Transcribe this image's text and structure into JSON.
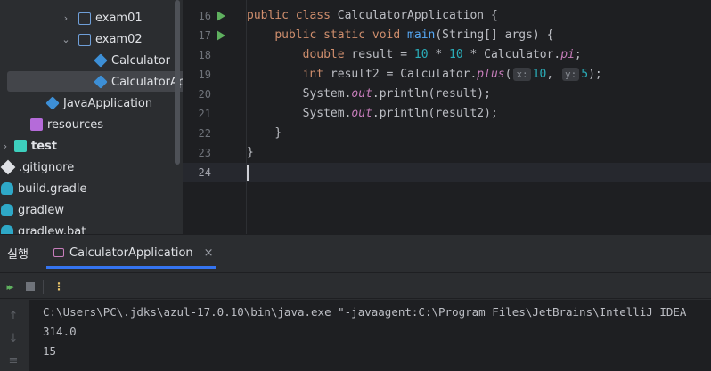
{
  "project_tree": {
    "items": [
      {
        "label": "exam01",
        "icon": "folder-icon",
        "expanded": false
      },
      {
        "label": "exam02",
        "icon": "folder-icon",
        "expanded": true
      },
      {
        "label": "Calculator",
        "icon": "class-icon"
      },
      {
        "label": "CalculatorApplication",
        "display": "CalculatorAp",
        "icon": "class-icon",
        "selected": true
      },
      {
        "label": "JavaApplication",
        "icon": "class-icon"
      },
      {
        "label": "resources",
        "icon": "resources-folder-icon"
      },
      {
        "label": "test",
        "icon": "test-folder-icon",
        "expanded": false
      },
      {
        "label": ".gitignore",
        "icon": "git-icon"
      },
      {
        "label": "build.gradle",
        "icon": "gradle-icon"
      },
      {
        "label": "gradlew",
        "icon": "gradle-icon"
      },
      {
        "label": "gradlew.bat",
        "icon": "gradle-icon"
      }
    ]
  },
  "editor": {
    "current_line": 24,
    "line_numbers": [
      "16",
      "17",
      "18",
      "19",
      "20",
      "21",
      "22",
      "23",
      "24"
    ],
    "lines": {
      "l16": {
        "kw1": "public",
        "kw2": "class",
        "name": "CalculatorApplication",
        "rest": " {"
      },
      "l17": {
        "kw1": "public",
        "kw2": "static",
        "kw3": "void",
        "fn": "main",
        "rest": "(String[] args) {"
      },
      "l18": {
        "kw": "double",
        "pre": " result = ",
        "n1": "10",
        "mid": " * ",
        "n2": "10",
        "mid2": " * Calculator.",
        "stat": "pi",
        "end": ";"
      },
      "l19": {
        "kw": "int",
        "pre": " result2 = Calculator.",
        "stat": "plus",
        "open": "(",
        "hint1": "x:",
        "v1": "10",
        "comma": ", ",
        "hint2": "y:",
        "v2": "5",
        "end": ");"
      },
      "l20": {
        "pre": "System.",
        "stat": "out",
        "rest": ".println(result);"
      },
      "l21": {
        "pre": "System.",
        "stat": "out",
        "rest": ".println(result2);"
      },
      "l22": "}",
      "l23": "}",
      "l24": ""
    }
  },
  "run_panel": {
    "label": "실행",
    "tab_label": "CalculatorApplication",
    "close_glyph": "×",
    "toolbar": {
      "rerun_glyph": "▸▸",
      "more_glyph": "⋮"
    },
    "output": [
      "C:\\Users\\PC\\.jdks\\azul-17.0.10\\bin\\java.exe \"-javaagent:C:\\Program Files\\JetBrains\\IntelliJ IDEA",
      "314.0",
      "15"
    ]
  },
  "colors": {
    "keyword": "#cf8e6d",
    "function": "#56a8f5",
    "number": "#2aacb8",
    "static_field": "#c77dbb",
    "run_icon": "#5fb05f",
    "selection": "#43454a",
    "tab_underline": "#3574f0"
  }
}
